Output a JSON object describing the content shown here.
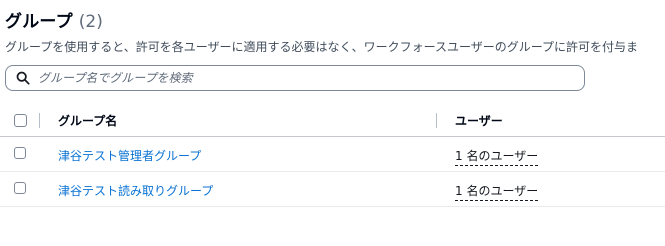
{
  "header": {
    "title": "グループ",
    "count": "(2)"
  },
  "description": "グループを使用すると、許可を各ユーザーに適用する必要はなく、ワークフォースユーザーのグループに許可を付与ま",
  "search": {
    "placeholder": "グループ名でグループを検索",
    "value": ""
  },
  "table": {
    "columns": {
      "name": "グループ名",
      "users": "ユーザー"
    },
    "rows": [
      {
        "name": "津谷テスト管理者グループ",
        "users": "1 名のユーザー"
      },
      {
        "name": "津谷テスト読み取りグループ",
        "users": "1 名のユーザー"
      }
    ]
  },
  "colors": {
    "link": "#0972d3",
    "text": "#16191f",
    "muted": "#5f6b7a",
    "border": "#7d8998"
  }
}
